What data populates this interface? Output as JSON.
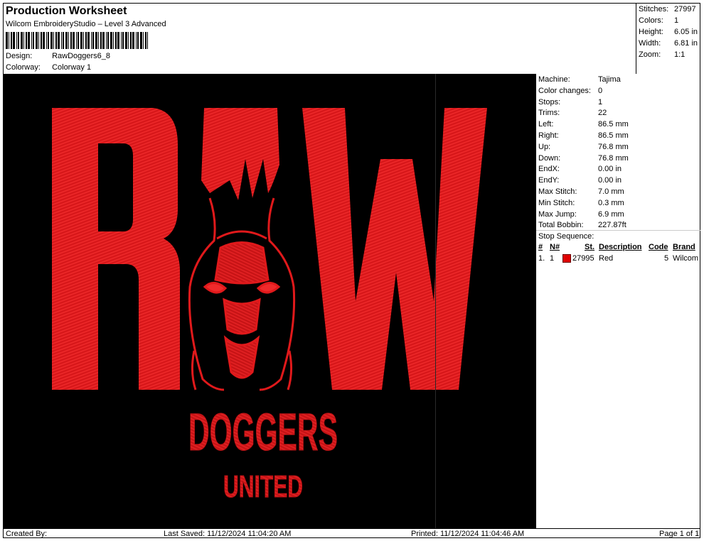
{
  "header": {
    "title": "Production Worksheet",
    "subtitle": "Wilcom EmbroideryStudio – Level 3 Advanced",
    "design_label": "Design:",
    "design_value": "RawDoggers6_8",
    "colorway_label": "Colorway:",
    "colorway_value": "Colorway 1"
  },
  "stats": [
    {
      "label": "Stitches:",
      "value": "27997"
    },
    {
      "label": "Colors:",
      "value": "1"
    },
    {
      "label": "Height:",
      "value": "6.05 in"
    },
    {
      "label": "Width:",
      "value": "6.81 in"
    },
    {
      "label": "Zoom:",
      "value": "1:1"
    }
  ],
  "machine_info": [
    {
      "label": "Machine:",
      "value": "Tajima"
    },
    {
      "label": "Color changes:",
      "value": "0"
    },
    {
      "label": "Stops:",
      "value": "1"
    },
    {
      "label": "Trims:",
      "value": "22"
    },
    {
      "label": "Left:",
      "value": "86.5 mm"
    },
    {
      "label": "Right:",
      "value": "86.5 mm"
    },
    {
      "label": "Up:",
      "value": "76.8 mm"
    },
    {
      "label": "Down:",
      "value": "76.8 mm"
    },
    {
      "label": "EndX:",
      "value": "0.00 in"
    },
    {
      "label": "EndY:",
      "value": "0.00 in"
    },
    {
      "label": "Max Stitch:",
      "value": "7.0 mm"
    },
    {
      "label": "Min Stitch:",
      "value": "0.3 mm"
    },
    {
      "label": "Max Jump:",
      "value": "6.9 mm"
    },
    {
      "label": "Total Bobbin:",
      "value": "227.87ft"
    }
  ],
  "stop_sequence": {
    "title": "Stop Sequence:",
    "columns": {
      "hash": "#",
      "n": "N#",
      "st": "St.",
      "desc": "Description",
      "code": "Code",
      "brand": "Brand"
    },
    "rows": [
      {
        "index": "1.",
        "n": "1",
        "stitches": "27995",
        "description": "Red",
        "code": "5",
        "brand": "Wilcom",
        "color": "#e00000"
      }
    ]
  },
  "design_art": {
    "line1": "RAW",
    "line2": "DOGGERS",
    "line3": "UNITED",
    "thread_color": "#e0191b",
    "background": "#000000"
  },
  "footer": {
    "created_by": "Created By:",
    "last_saved": "Last Saved: 11/12/2024 11:04:20 AM",
    "printed": "Printed: 11/12/2024 11:04:46 AM",
    "page": "Page 1 of 1"
  }
}
